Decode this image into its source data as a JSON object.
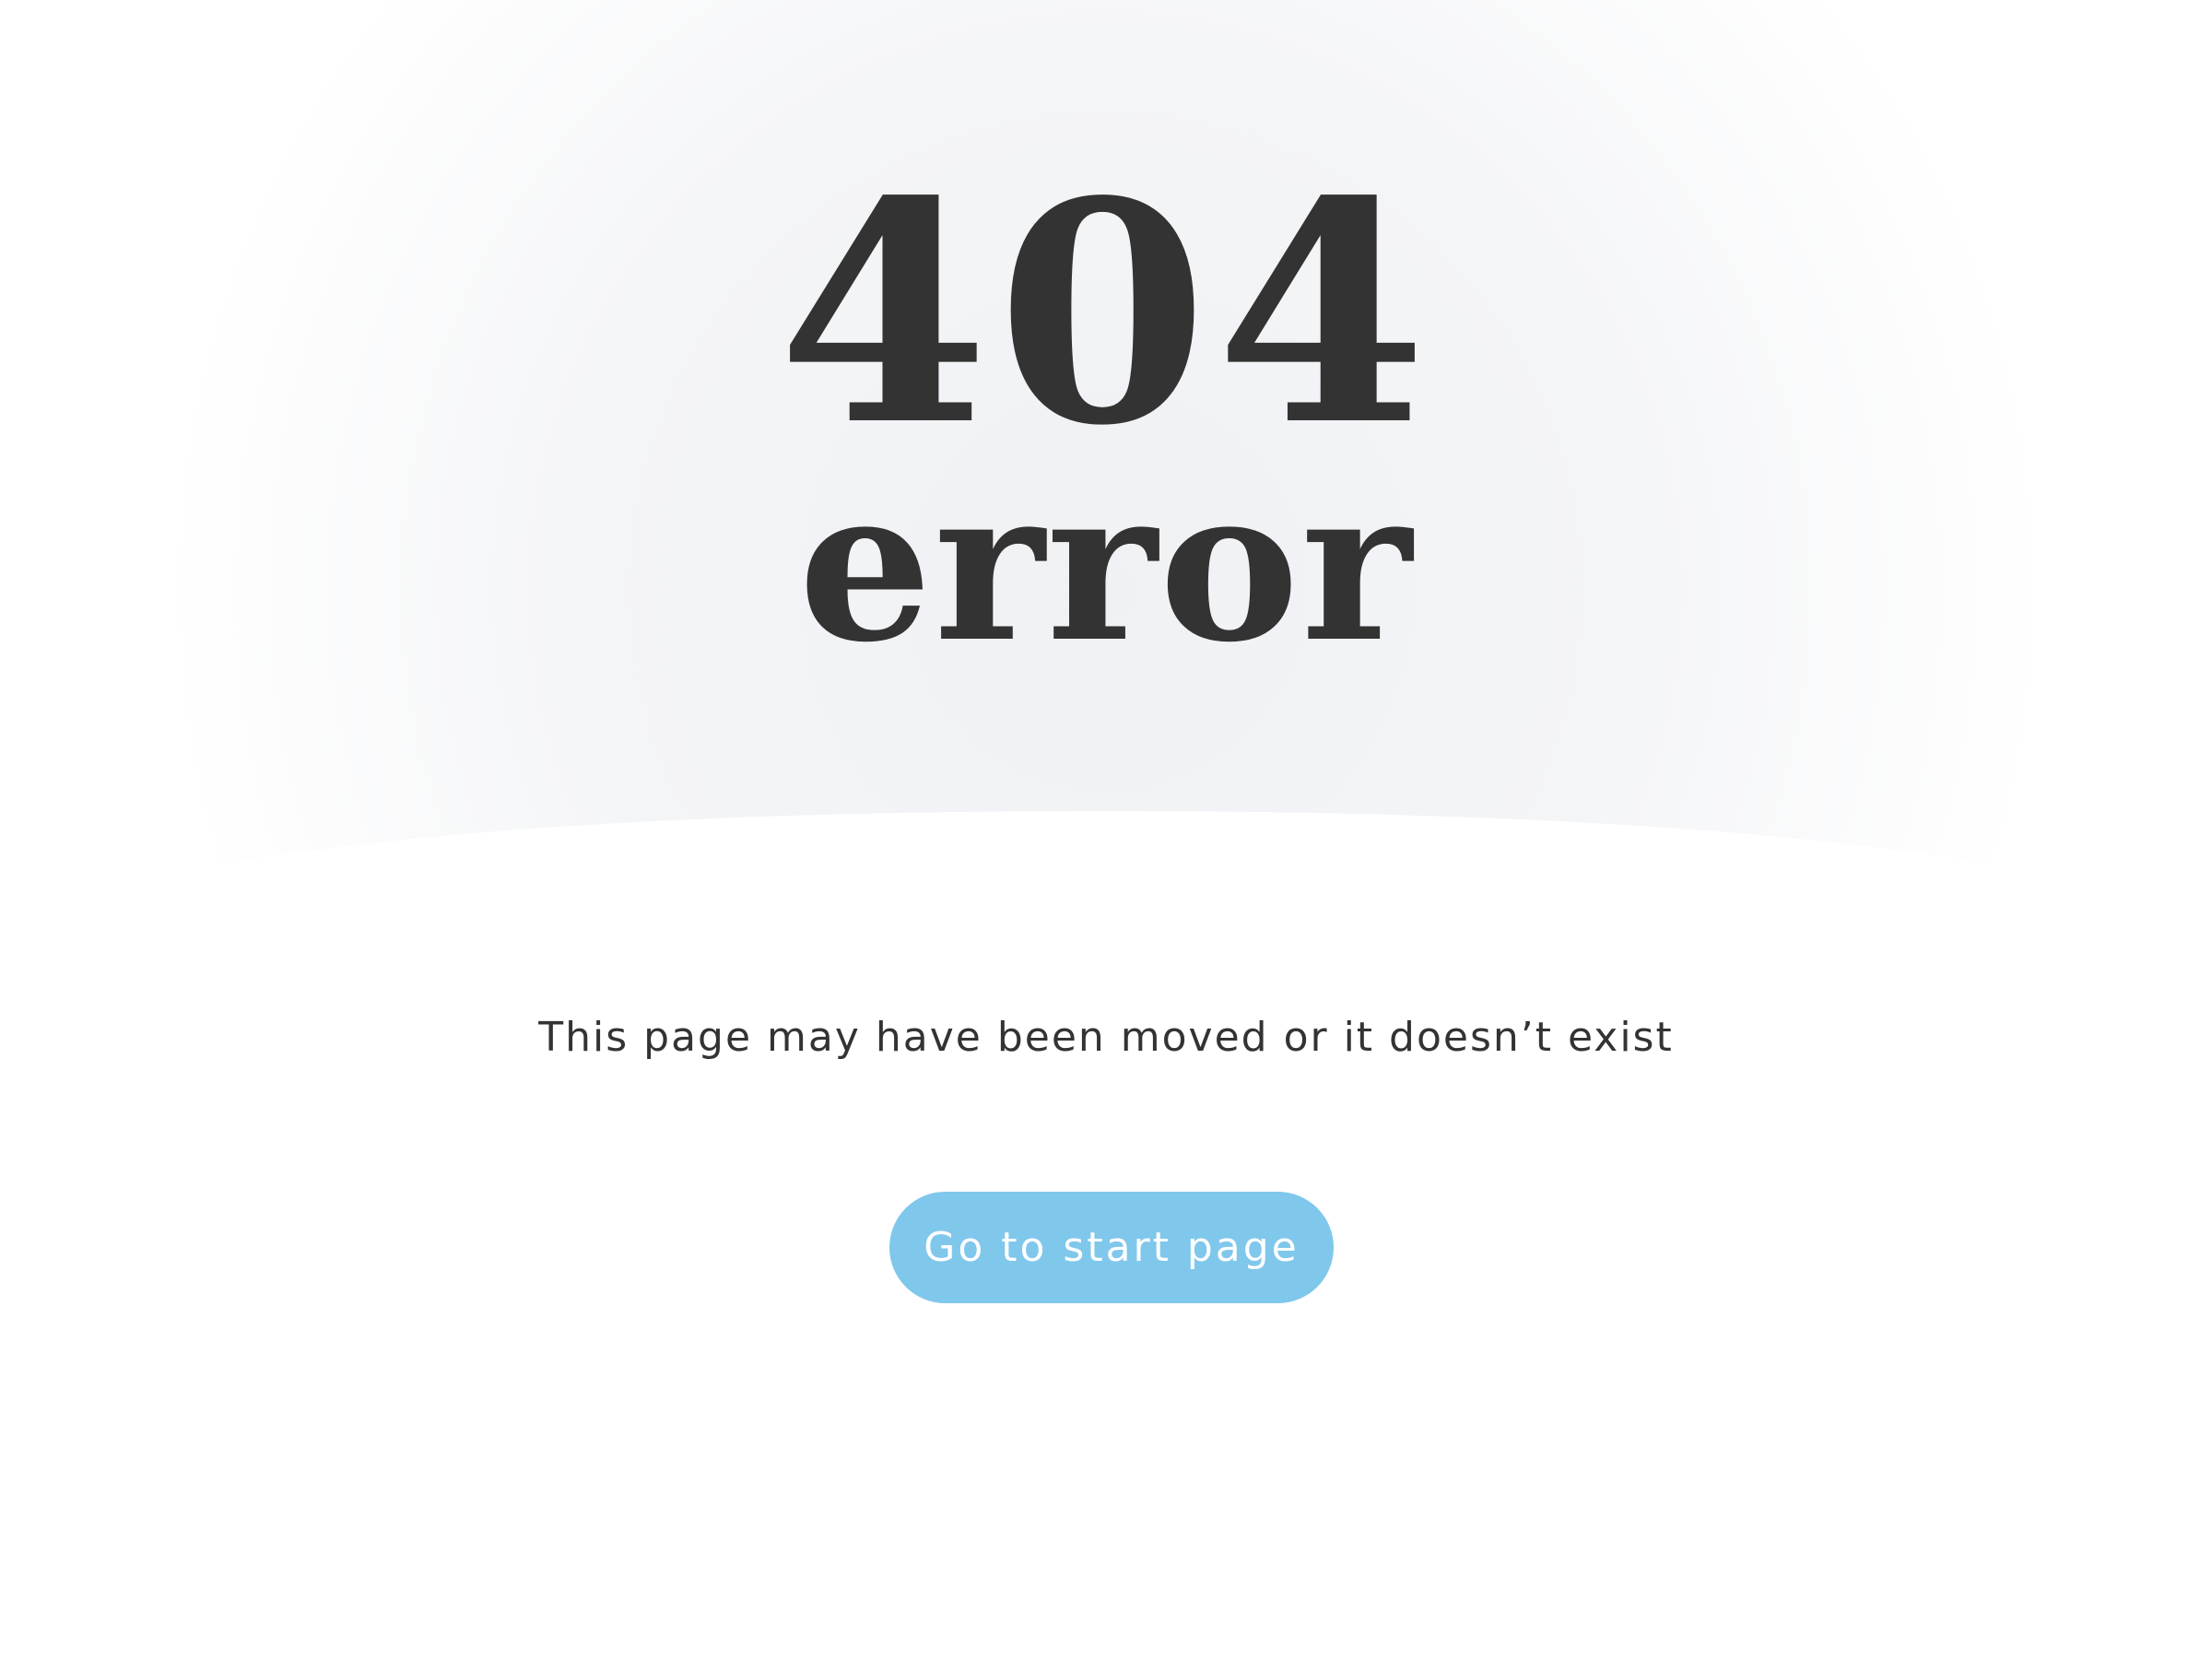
{
  "error": {
    "code": "404",
    "word": "error",
    "message": "This page may have been moved or it doesn’t exist"
  },
  "actions": {
    "start_page_label": "Go to start page"
  },
  "colors": {
    "text": "#333333",
    "button": "#80c7ec",
    "button_text": "#ffffff",
    "background": "#ffffff",
    "hero_tint": "#eff1f4"
  }
}
